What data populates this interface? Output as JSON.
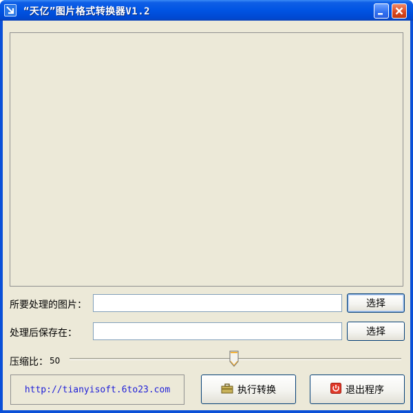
{
  "window": {
    "title": "“天亿”图片格式转换器V1.2"
  },
  "form": {
    "source_label": "所要处理的图片：",
    "source_value": "",
    "source_button": "选择",
    "dest_label": "处理后保存在：",
    "dest_value": "",
    "dest_button": "选择"
  },
  "compression": {
    "label": "压缩比：",
    "value": 50,
    "display_value": "50",
    "min": 0,
    "max": 100
  },
  "footer": {
    "url": "http://tianyisoft.6to23.com",
    "convert_button": "执行转换",
    "exit_button": "退出程序"
  },
  "icons": {
    "app": "app-arrow-icon",
    "minimize": "minimize-icon",
    "close": "close-icon",
    "convert": "toolbox-icon",
    "exit": "power-icon"
  },
  "colors": {
    "titlebar": "#0054e3",
    "client_bg": "#ece9d8",
    "url_text": "#1c1cd8",
    "close_button": "#d9461e"
  }
}
